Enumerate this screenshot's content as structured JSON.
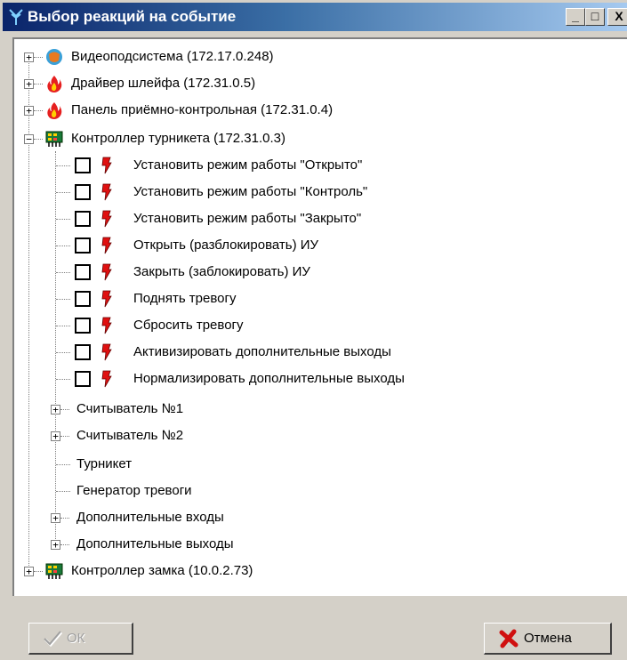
{
  "window": {
    "title": "Выбор реакций на событие",
    "buttons": {
      "minimize": "_",
      "maximize": "□",
      "close": "X"
    }
  },
  "tree": {
    "nodes": [
      {
        "label": "Видеоподсистема (172.17.0.248)",
        "icon": "video-subsystem-icon",
        "expanded": false
      },
      {
        "label": "Драйвер шлейфа (172.31.0.5)",
        "icon": "fire-icon",
        "expanded": false
      },
      {
        "label": "Панель приёмно-контрольная (172.31.0.4)",
        "icon": "fire-icon",
        "expanded": false
      },
      {
        "label": "Контроллер турникета (172.31.0.3)",
        "icon": "controller-icon",
        "expanded": true,
        "actions": [
          "Установить режим работы \"Открыто\"",
          "Установить режим работы \"Контроль\"",
          "Установить режим работы \"Закрыто\"",
          "Открыть (разблокировать) ИУ",
          "Закрыть (заблокировать) ИУ",
          "Поднять тревогу",
          "Сбросить тревогу",
          "Активизировать дополнительные выходы",
          "Нормализировать дополнительные выходы"
        ],
        "children": [
          {
            "label": "Считыватель №1",
            "expandable": true
          },
          {
            "label": "Считыватель №2",
            "expandable": true
          },
          {
            "label": "Турникет",
            "expandable": false
          },
          {
            "label": "Генератор тревоги",
            "expandable": false
          },
          {
            "label": "Дополнительные входы",
            "expandable": true
          },
          {
            "label": "Дополнительные выходы",
            "expandable": true
          }
        ]
      },
      {
        "label": "Контроллер замка  (10.0.2.73)",
        "icon": "controller-icon",
        "expanded": false
      }
    ]
  },
  "footer": {
    "ok_label": "ОК",
    "cancel_label": "Отмена"
  },
  "colors": {
    "title_start": "#0a246a",
    "title_end": "#a6caf0",
    "face": "#d4d0c8",
    "alarm": "#e01010"
  }
}
